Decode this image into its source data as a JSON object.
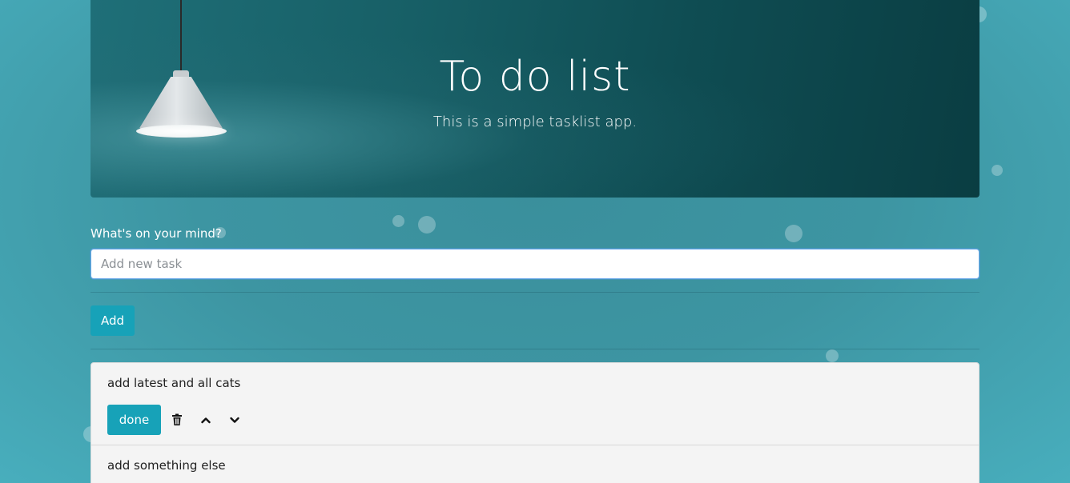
{
  "header": {
    "title": "To do list",
    "subtitle": "This is a simple tasklist app."
  },
  "form": {
    "label": "What's on your mind?",
    "input_placeholder": "Add new task",
    "input_value": "",
    "add_label": "Add"
  },
  "tasks": [
    {
      "text": "add latest and all cats",
      "done_label": "done",
      "icons": [
        "trash-icon",
        "chevron-up-icon",
        "chevron-down-icon"
      ]
    },
    {
      "text": "add something else"
    }
  ],
  "colors": {
    "accent": "#17a2b8",
    "background": "#3d95a2",
    "list_bg": "#f4f4f4"
  }
}
